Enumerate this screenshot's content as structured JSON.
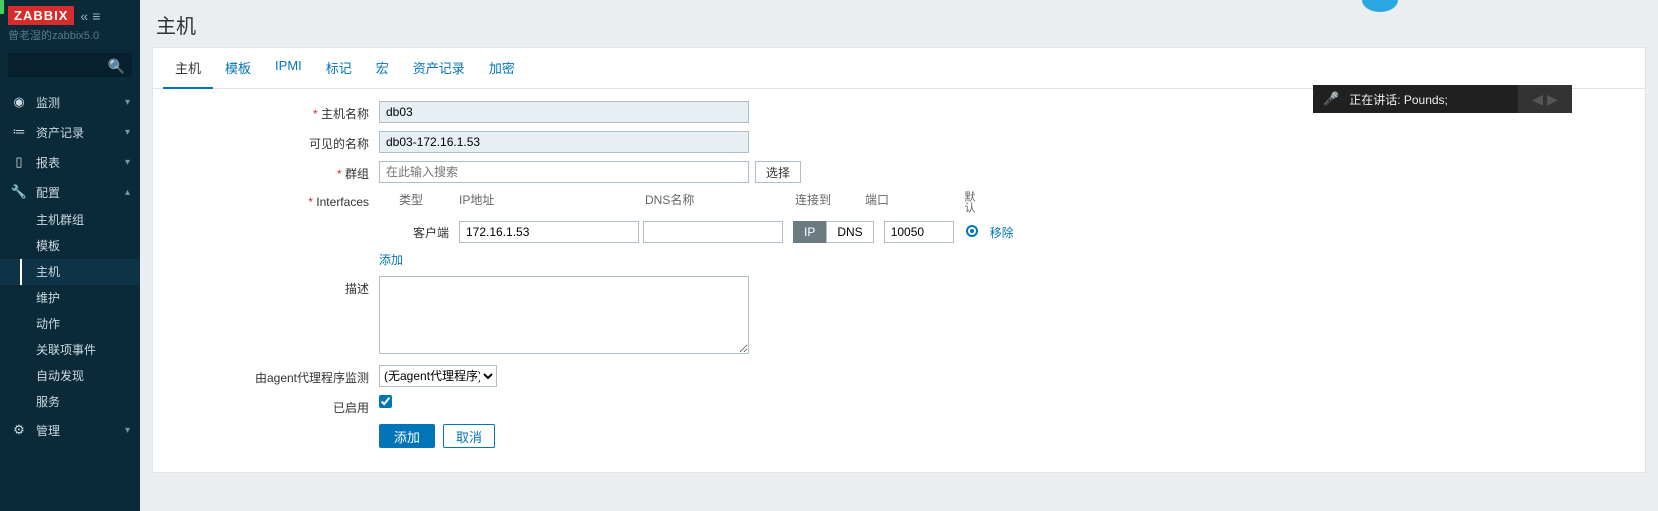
{
  "sidebar": {
    "logo": "ZABBIX",
    "subtitle": "曾老湿的zabbix5.0",
    "sections": [
      {
        "icon": "◉",
        "label": "监测",
        "expanded": false
      },
      {
        "icon": "≡",
        "label": "资产记录",
        "expanded": false
      },
      {
        "icon": "▮",
        "label": "报表",
        "expanded": false
      },
      {
        "icon": "✦",
        "label": "配置",
        "expanded": true,
        "items": [
          {
            "label": "主机群组"
          },
          {
            "label": "模板"
          },
          {
            "label": "主机",
            "active": true
          },
          {
            "label": "维护"
          },
          {
            "label": "动作"
          },
          {
            "label": "关联项事件"
          },
          {
            "label": "自动发现"
          },
          {
            "label": "服务"
          }
        ]
      },
      {
        "icon": "⚙",
        "label": "管理",
        "expanded": false
      }
    ]
  },
  "page": {
    "title": "主机"
  },
  "tabs": [
    {
      "label": "主机",
      "active": true
    },
    {
      "label": "模板"
    },
    {
      "label": "IPMI"
    },
    {
      "label": "标记"
    },
    {
      "label": "宏"
    },
    {
      "label": "资产记录"
    },
    {
      "label": "加密"
    }
  ],
  "form": {
    "hostname_label": "主机名称",
    "hostname_value": "db03",
    "visiblename_label": "可见的名称",
    "visiblename_value": "db03-172.16.1.53",
    "groups_label": "群组",
    "groups_placeholder": "在此输入搜索",
    "groups_select_btn": "选择",
    "interfaces_label": "Interfaces",
    "iface_head": {
      "type": "类型",
      "ip": "IP地址",
      "dns": "DNS名称",
      "conn": "连接到",
      "port": "端口",
      "def": "默认"
    },
    "iface_row": {
      "type": "客户端",
      "ip": "172.16.1.53",
      "dns": "",
      "conn_ip": "IP",
      "conn_dns": "DNS",
      "port": "10050",
      "remove": "移除"
    },
    "add_link": "添加",
    "description_label": "描述",
    "proxy_label": "由agent代理程序监测",
    "proxy_value": "(无agent代理程序)",
    "enabled_label": "已启用",
    "submit": "添加",
    "cancel": "取消"
  },
  "overlay": {
    "speaking": "正在讲话: Pounds;"
  }
}
